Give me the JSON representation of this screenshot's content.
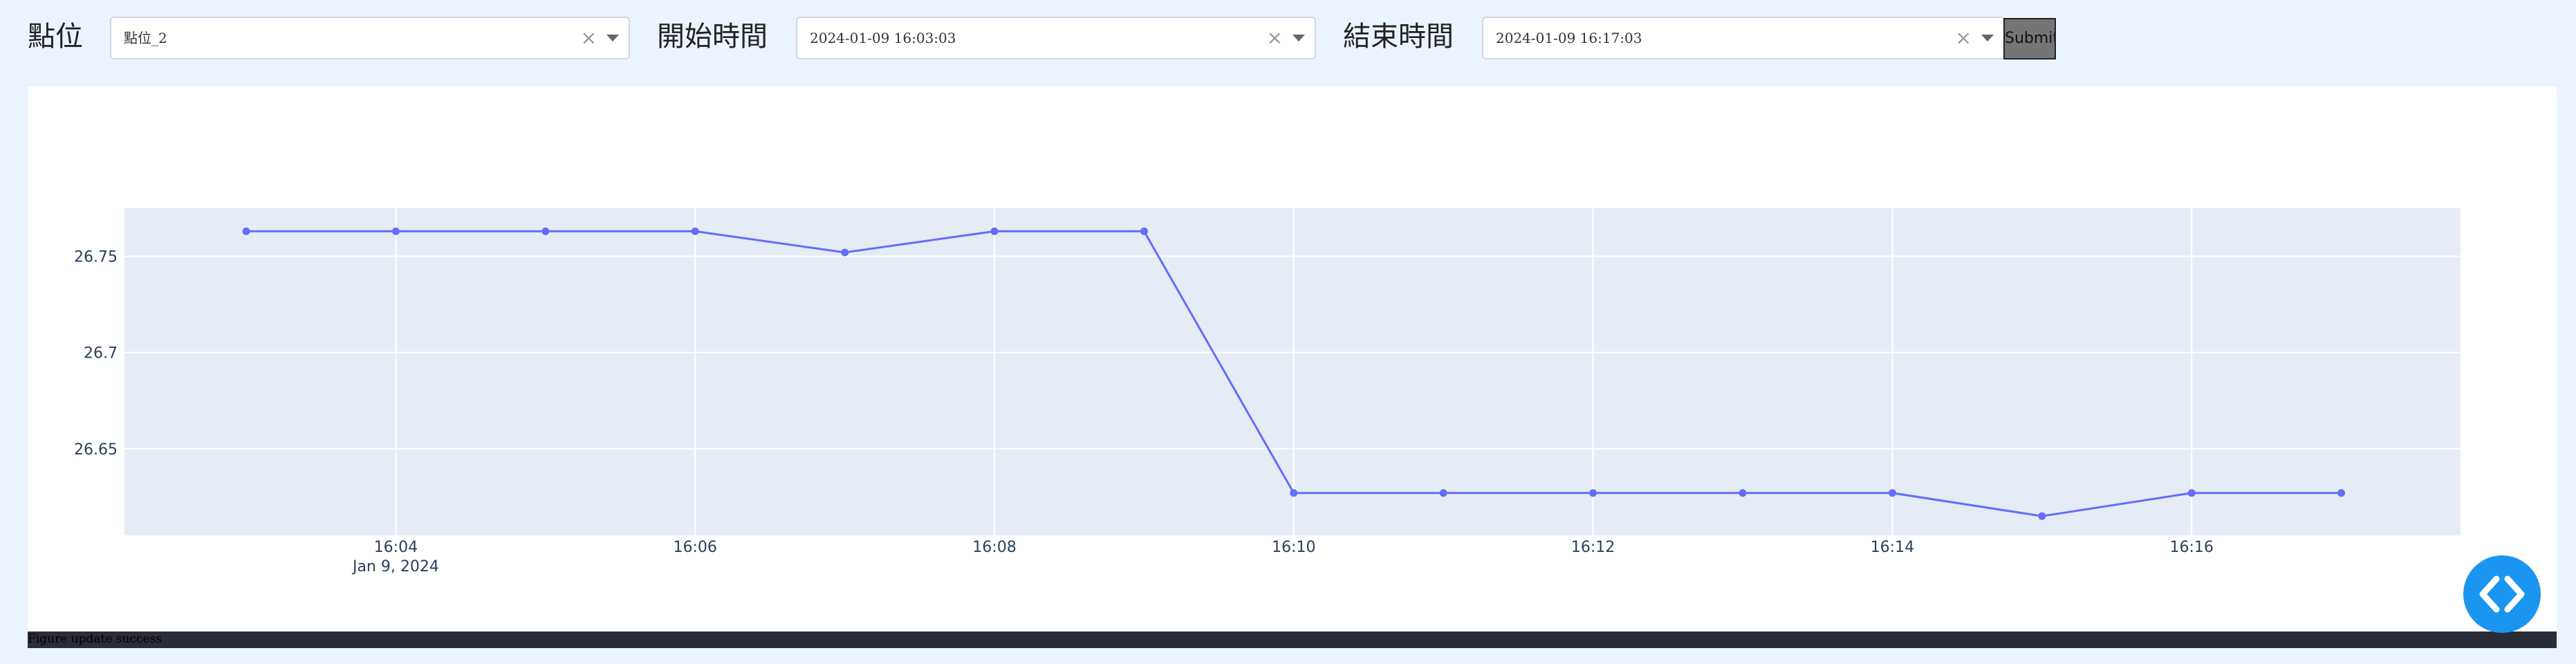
{
  "filters": {
    "point_label": "點位",
    "point_value": "點位_2",
    "start_label": "開始時間",
    "start_value": "2024-01-09 16:03:03",
    "end_label": "結束時間",
    "end_value": "2024-01-09 16:17:03",
    "clear_glyph": "×",
    "submit_label": "Submit"
  },
  "status": {
    "text": "Figure update success"
  },
  "colors": {
    "line": "#636efa",
    "plot_bg": "#e5ecf6",
    "page_bg": "#ebf3fe",
    "fab": "#1a96f0"
  },
  "fab": {
    "icon": "code-brackets-icon"
  },
  "chart_data": {
    "type": "line",
    "x": [
      "16:03",
      "16:04",
      "16:05",
      "16:06",
      "16:07",
      "16:08",
      "16:09",
      "16:10",
      "16:11",
      "16:12",
      "16:13",
      "16:14",
      "16:15",
      "16:16",
      "16:17"
    ],
    "series": [
      {
        "values": [
          26.763,
          26.763,
          26.763,
          26.763,
          26.752,
          26.763,
          26.763,
          26.627,
          26.627,
          26.627,
          26.627,
          26.627,
          26.615,
          26.627,
          26.627
        ]
      }
    ],
    "x_ticks": [
      "16:04",
      "16:06",
      "16:08",
      "16:10",
      "16:12",
      "16:14",
      "16:16"
    ],
    "x_tick_sub": "Jan 9, 2024",
    "y_ticks": [
      "26.75",
      "26.7",
      "26.65"
    ],
    "ylim": [
      26.605,
      26.775
    ],
    "grid": true
  }
}
